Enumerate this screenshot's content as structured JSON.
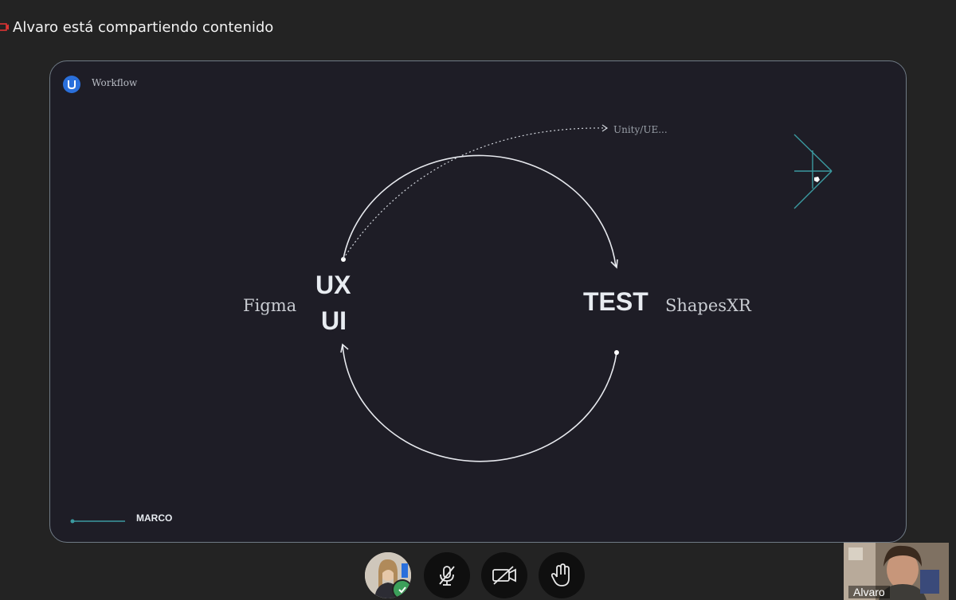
{
  "banner": {
    "text": "Alvaro está compartiendo contenido",
    "icon": "camera-icon"
  },
  "slide": {
    "title": "Workflow",
    "labels": {
      "figma": "Figma",
      "ux": "UX",
      "ui": "UI",
      "test": "TEST",
      "shapes": "ShapesXR",
      "unity": "Unity/UE...",
      "marco": "MARCO"
    },
    "colors": {
      "background": "#1e1d26",
      "accent": "#3b9aa0",
      "logo": "#2a6fdb"
    }
  },
  "controls": {
    "buttons": [
      "avatar",
      "mic-muted",
      "camera-off",
      "raise-hand"
    ],
    "avatar_status": "connected"
  },
  "self_view": {
    "name": "Alvaro"
  }
}
